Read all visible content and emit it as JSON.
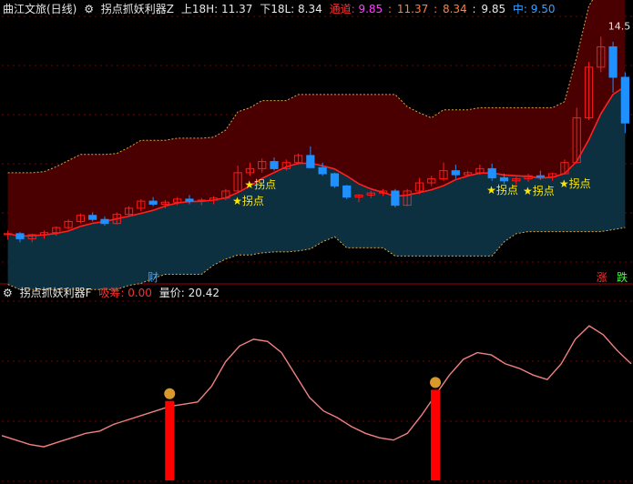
{
  "colors": {
    "bg": "#000000",
    "grid": "#7a0000",
    "upper_band": "#4a0000",
    "lower_band": "#0c3040",
    "band_edge": "#d9a84a",
    "up_candle": "#ff1a1a",
    "down_candle": "#1e90ff",
    "mid_line": "#ff2020",
    "lower_line": "#ffffff",
    "curve": "#f08080",
    "signal_bar": "#ff0000",
    "white": "#e8e8e8",
    "red_text": "#ff3030",
    "purple": "#ff40ff",
    "orange": "#ff8040",
    "blue": "#3aa0ff",
    "yellow_star": "#ffe600"
  },
  "top_header": {
    "stock": "曲江文旅(日线)",
    "gear_icon": "gear-icon",
    "indicator": "拐点抓妖利器Z",
    "upper_label": "上18H:",
    "upper_value": "11.37",
    "lower_label": "下18L:",
    "lower_value": "8.34",
    "channel_label": "通道:",
    "channel_v1": "9.85",
    "sep1": ":",
    "channel_v2": "11.37",
    "sep2": ":",
    "channel_v3": "8.34",
    "sep3": ":",
    "channel_v4": "9.85",
    "mid_label": "中:",
    "mid_value": "9.50"
  },
  "bottom_header": {
    "gear_icon": "gear-icon",
    "indicator": "拐点抓妖利器F",
    "absorb_label": "吸筹:",
    "absorb_value": "0.00",
    "qp_label": "量价:",
    "qp_value": "20.42"
  },
  "markers": {
    "high_price": "14.5",
    "turn_label": "拐点",
    "cai": "财",
    "zhang": "涨",
    "die": "跌"
  },
  "chart_data": [
    {
      "type": "candlestick",
      "title": "拐点抓妖利器Z",
      "series": [
        {
          "name": "上18H",
          "last": 11.37
        },
        {
          "name": "下18L",
          "last": 8.34
        },
        {
          "name": "中",
          "last": 9.5
        }
      ],
      "candles": [
        [
          7.7,
          7.78,
          7.6,
          7.72
        ],
        [
          7.72,
          7.75,
          7.55,
          7.62
        ],
        [
          7.62,
          7.72,
          7.55,
          7.7
        ],
        [
          7.7,
          7.78,
          7.62,
          7.74
        ],
        [
          7.74,
          7.86,
          7.68,
          7.84
        ],
        [
          7.84,
          8.0,
          7.8,
          7.96
        ],
        [
          7.96,
          8.12,
          7.92,
          8.08
        ],
        [
          8.08,
          8.14,
          7.96,
          8.0
        ],
        [
          8.0,
          8.06,
          7.88,
          7.92
        ],
        [
          7.92,
          8.14,
          7.9,
          8.1
        ],
        [
          8.1,
          8.26,
          8.06,
          8.22
        ],
        [
          8.22,
          8.4,
          8.16,
          8.36
        ],
        [
          8.36,
          8.44,
          8.26,
          8.3
        ],
        [
          8.3,
          8.38,
          8.22,
          8.34
        ],
        [
          8.34,
          8.44,
          8.28,
          8.4
        ],
        [
          8.4,
          8.48,
          8.3,
          8.36
        ],
        [
          8.36,
          8.42,
          8.28,
          8.38
        ],
        [
          8.38,
          8.46,
          8.3,
          8.42
        ],
        [
          8.42,
          8.6,
          8.38,
          8.56
        ],
        [
          8.56,
          9.06,
          8.54,
          8.92
        ],
        [
          8.92,
          9.12,
          8.86,
          9.0
        ],
        [
          9.0,
          9.2,
          8.92,
          9.14
        ],
        [
          9.14,
          9.22,
          8.96,
          9.0
        ],
        [
          9.0,
          9.18,
          8.96,
          9.12
        ],
        [
          9.12,
          9.3,
          9.08,
          9.26
        ],
        [
          9.26,
          9.44,
          9.2,
          9.02
        ],
        [
          9.02,
          9.12,
          8.86,
          8.9
        ],
        [
          8.9,
          8.92,
          8.62,
          8.66
        ],
        [
          8.66,
          8.68,
          8.4,
          8.44
        ],
        [
          8.44,
          8.5,
          8.34,
          8.48
        ],
        [
          8.48,
          8.56,
          8.42,
          8.52
        ],
        [
          8.52,
          8.6,
          8.46,
          8.56
        ],
        [
          8.56,
          8.6,
          8.24,
          8.28
        ],
        [
          8.28,
          8.6,
          8.26,
          8.56
        ],
        [
          8.56,
          8.82,
          8.5,
          8.72
        ],
        [
          8.72,
          8.86,
          8.66,
          8.8
        ],
        [
          8.8,
          9.12,
          8.76,
          8.96
        ],
        [
          8.96,
          9.08,
          8.8,
          8.88
        ],
        [
          8.88,
          8.96,
          8.84,
          8.92
        ],
        [
          8.92,
          9.08,
          8.88,
          9.0
        ],
        [
          9.0,
          9.1,
          8.76,
          8.82
        ],
        [
          8.82,
          8.9,
          8.7,
          8.76
        ],
        [
          8.76,
          8.84,
          8.68,
          8.8
        ],
        [
          8.8,
          8.9,
          8.74,
          8.86
        ],
        [
          8.86,
          8.96,
          8.78,
          8.84
        ],
        [
          8.84,
          8.92,
          8.76,
          8.9
        ],
        [
          8.9,
          9.18,
          8.88,
          9.12
        ],
        [
          9.12,
          10.2,
          9.1,
          10.0
        ],
        [
          10.0,
          11.1,
          9.96,
          11.0
        ],
        [
          11.0,
          11.6,
          10.9,
          11.4
        ],
        [
          11.4,
          11.5,
          10.5,
          10.8
        ],
        [
          10.8,
          10.9,
          9.7,
          9.9
        ]
      ],
      "ylim": [
        7.0,
        12.0
      ]
    },
    {
      "type": "line",
      "title": "拐点抓妖利器F",
      "series": [
        {
          "name": "量价",
          "values": [
            20,
            18,
            16,
            15,
            17,
            19,
            21,
            22,
            25,
            27,
            29,
            31,
            33,
            34,
            35,
            42,
            53,
            60,
            63,
            62,
            57,
            47,
            37,
            31,
            28,
            24,
            21,
            19,
            18,
            21,
            29,
            38,
            47,
            54,
            57,
            56,
            52,
            50,
            47,
            45,
            52,
            63,
            69,
            65,
            58,
            52
          ]
        },
        {
          "name": "吸筹",
          "values": [
            0,
            0,
            0,
            0,
            0,
            0,
            0,
            0,
            0,
            0,
            0,
            0,
            0,
            0,
            0,
            0,
            0,
            0,
            0,
            0,
            0,
            0,
            0,
            0,
            0,
            0,
            0,
            0,
            0,
            0,
            0,
            0,
            0,
            0,
            0,
            0,
            0,
            0,
            0,
            0,
            0,
            0,
            0,
            0,
            0,
            0
          ]
        }
      ],
      "signals": [
        12,
        31
      ],
      "ylim": [
        0,
        80
      ]
    }
  ]
}
